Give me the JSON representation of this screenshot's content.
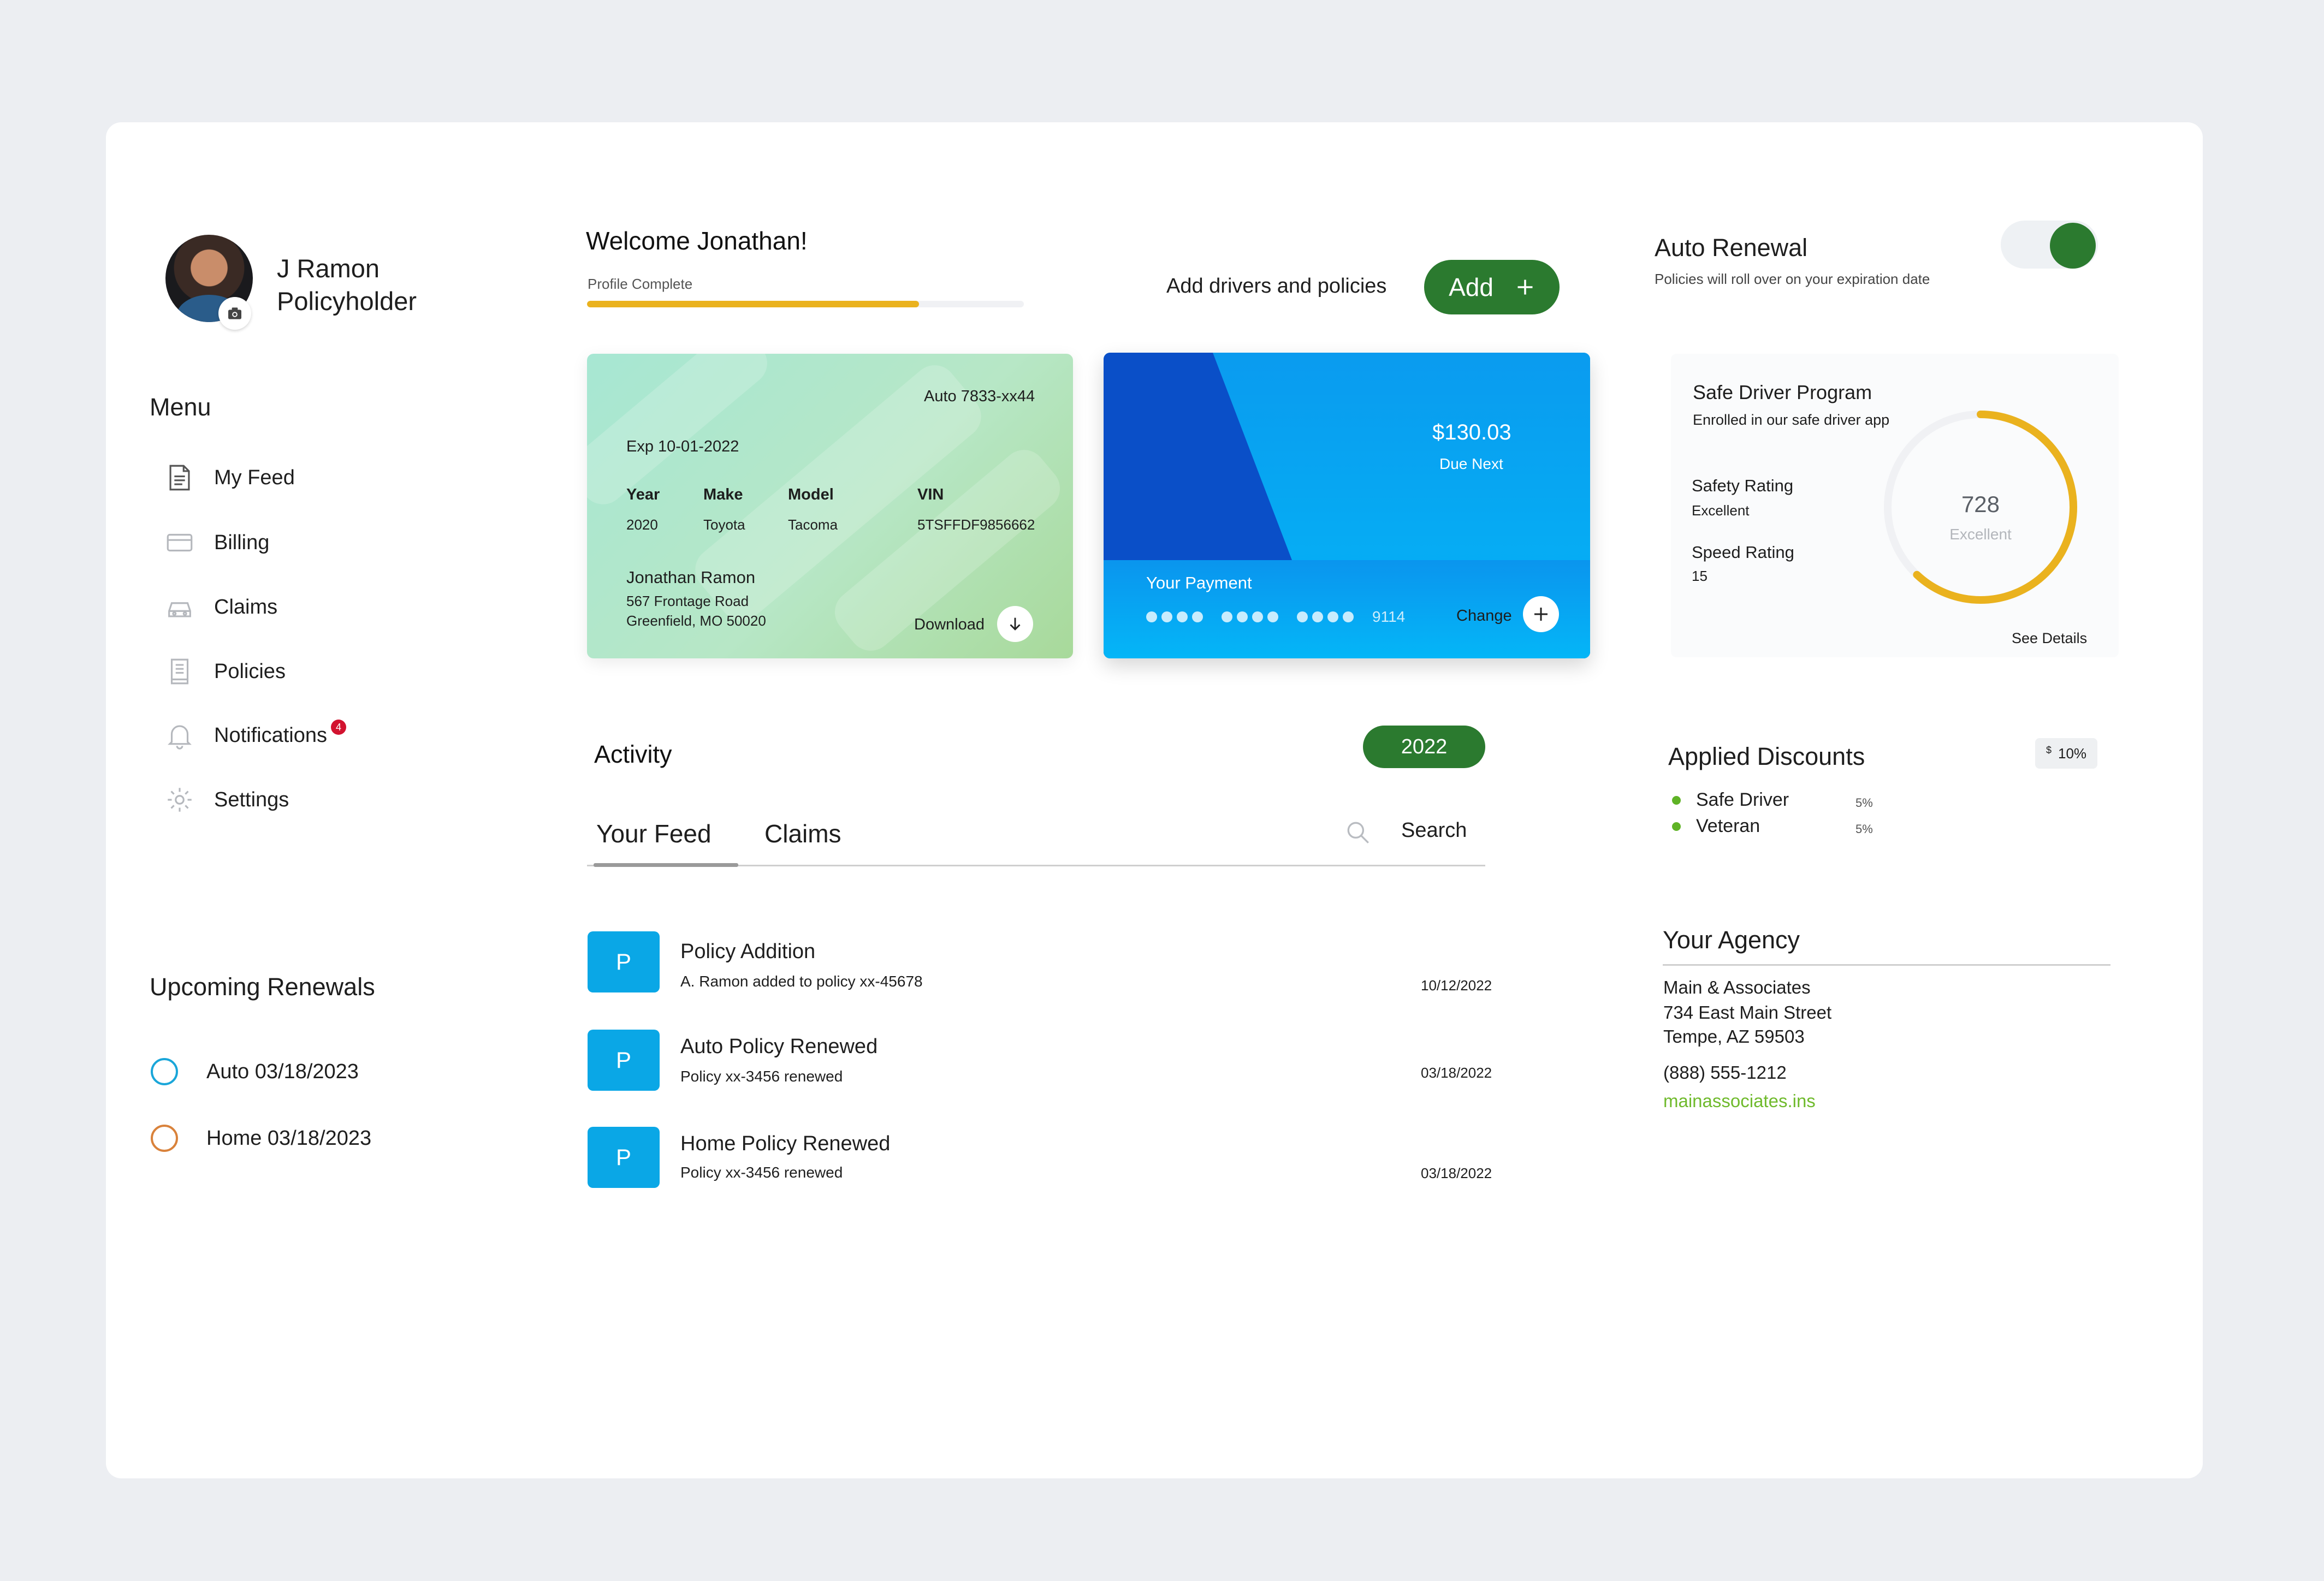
{
  "user": {
    "name_line1": "J Ramon",
    "name_line2": "Policyholder"
  },
  "menu": {
    "title": "Menu",
    "items": [
      {
        "label": "My Feed",
        "icon": "feed-icon"
      },
      {
        "label": "Billing",
        "icon": "card-icon"
      },
      {
        "label": "Claims",
        "icon": "car-icon"
      },
      {
        "label": "Policies",
        "icon": "document-icon"
      },
      {
        "label": "Notifications",
        "icon": "bell-icon",
        "badge": "4"
      },
      {
        "label": "Settings",
        "icon": "gear-icon"
      }
    ]
  },
  "renewals": {
    "title": "Upcoming Renewals",
    "items": [
      {
        "label": "Auto 03/18/2023",
        "color": "#1aa6d9"
      },
      {
        "label": "Home 03/18/2023",
        "color": "#d9823b"
      }
    ]
  },
  "welcome": {
    "title": "Welcome Jonathan!",
    "profile_label": "Profile Complete",
    "profile_progress": 0.76,
    "add_prompt": "Add drivers and policies",
    "add_button": "Add"
  },
  "auto_card": {
    "policy": "Auto 7833-xx44",
    "exp": "Exp 10-01-2022",
    "headers": [
      "Year",
      "Make",
      "Model",
      "VIN"
    ],
    "values": [
      "2020",
      "Toyota",
      "Tacoma",
      "5TSFFDF9856662"
    ],
    "owner": "Jonathan Ramon",
    "address1": "567 Frontage Road",
    "address2": "Greenfield, MO 50020",
    "download": "Download"
  },
  "payment_card": {
    "amount": "$130.03",
    "due": "Due Next",
    "label": "Your Payment",
    "last4": "9114",
    "change": "Change"
  },
  "activity": {
    "title": "Activity",
    "year": "2022",
    "tabs": [
      "Your Feed",
      "Claims"
    ],
    "search": "Search",
    "feed": [
      {
        "initial": "P",
        "title": "Policy Addition",
        "sub": "A. Ramon added to policy xx-45678",
        "date": "10/12/2022"
      },
      {
        "initial": "P",
        "title": "Auto Policy Renewed",
        "sub": "Policy xx-3456 renewed",
        "date": "03/18/2022"
      },
      {
        "initial": "P",
        "title": "Home Policy Renewed",
        "sub": "Policy xx-3456 renewed",
        "date": "03/18/2022"
      }
    ]
  },
  "auto_renewal": {
    "title": "Auto Renewal",
    "sub": "Policies will roll over on your expiration date",
    "enabled": true
  },
  "safe_driver": {
    "title": "Safe Driver Program",
    "sub": "Enrolled in our safe driver app",
    "safety_label": "Safety Rating",
    "safety_value": "Excellent",
    "speed_label": "Speed Rating",
    "speed_value": "15",
    "score": "728",
    "score_label": "Excellent",
    "score_fraction": 0.62,
    "see_details": "See Details",
    "accent": "#eab21e"
  },
  "discounts": {
    "title": "Applied Discounts",
    "badge_symbol": "$",
    "badge_value": "10%",
    "items": [
      {
        "label": "Safe Driver",
        "pct": "5%"
      },
      {
        "label": "Veteran",
        "pct": "5%"
      }
    ]
  },
  "agency": {
    "title": "Your Agency",
    "name": "Main & Associates",
    "street": "734 East Main Street",
    "city": "Tempe, AZ 59503",
    "phone": "(888) 555-1212",
    "website": "mainassociates.ins"
  }
}
